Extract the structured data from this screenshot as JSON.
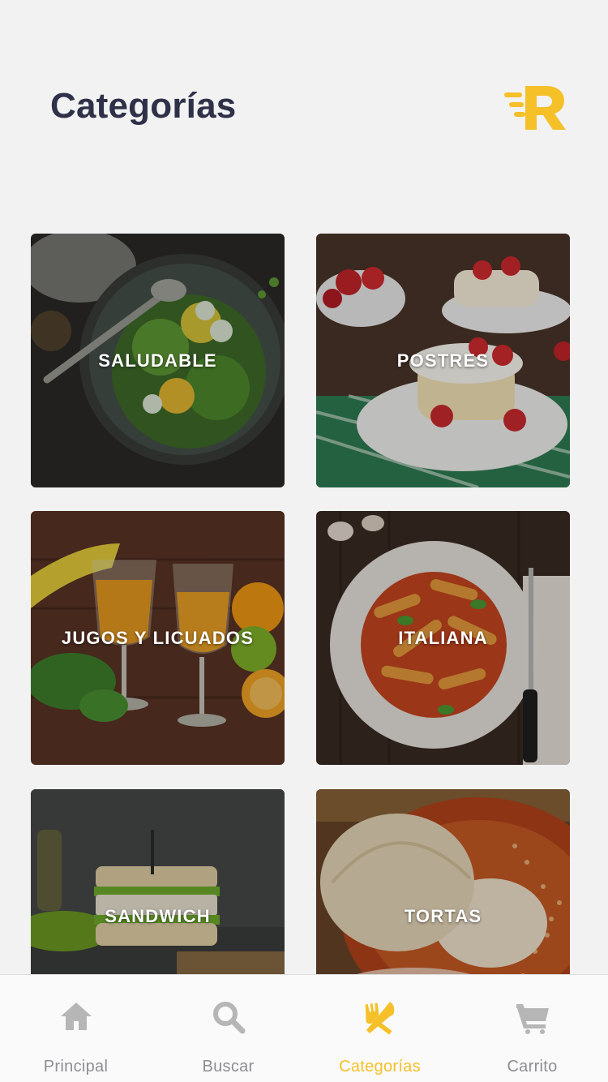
{
  "header": {
    "title": "Categorías",
    "logo": "R",
    "logo_color": "#f5c028"
  },
  "categories": [
    {
      "label": "SALUDABLE",
      "image": "salad-photo"
    },
    {
      "label": "POSTRES",
      "image": "strawberry-cake-photo"
    },
    {
      "label": "JUGOS Y LICUADOS",
      "image": "juice-photo"
    },
    {
      "label": "ITALIANA",
      "image": "pasta-photo"
    },
    {
      "label": "SANDWICH",
      "image": "sandwich-photo"
    },
    {
      "label": "TORTAS",
      "image": "torta-photo"
    }
  ],
  "tabbar": {
    "active_tab": "Categorías",
    "active_color": "#f5c028",
    "inactive_color": "#8e8e93",
    "tabs": [
      {
        "label": "Principal",
        "icon": "home-icon"
      },
      {
        "label": "Buscar",
        "icon": "search-icon"
      },
      {
        "label": "Categorías",
        "icon": "fork-knife-icon"
      },
      {
        "label": "Carrito",
        "icon": "cart-icon"
      }
    ]
  }
}
